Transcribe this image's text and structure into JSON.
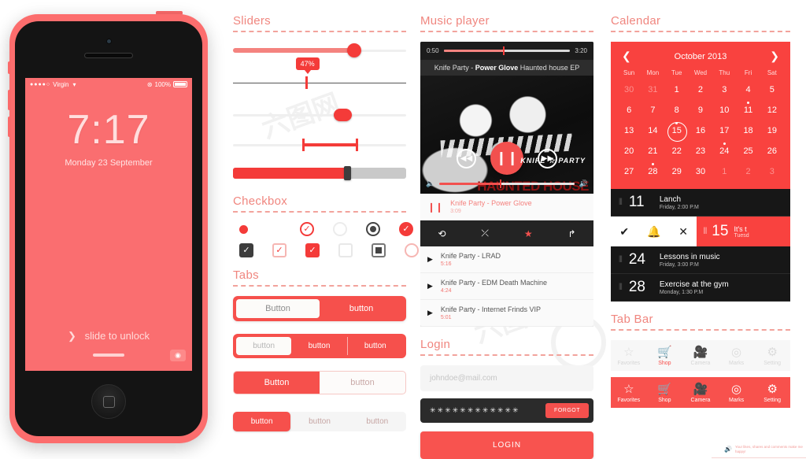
{
  "phone": {
    "status": {
      "carrier": "Virgin",
      "signal_dots": "●●●●○",
      "wifi": "wifi-icon",
      "lock": "⊛",
      "battery_pct": "100%"
    },
    "lock_time": "7:17",
    "lock_date": "Monday 23 September",
    "slide_text": "slide to unlock",
    "slide_chevron": "❯",
    "camera_icon": "◉"
  },
  "sliders": {
    "title": "Sliders",
    "bubble_value": "47%",
    "rows": [
      {
        "name": "filled-knob-slider",
        "value": 78
      },
      {
        "name": "tooltip-tick-slider",
        "value": 47
      },
      {
        "name": "oval-knob-slider",
        "value": 65
      },
      {
        "name": "range-slider",
        "value_from": 42,
        "value_to": 72
      },
      {
        "name": "thick-bar-slider",
        "value": 72
      }
    ]
  },
  "checkbox": {
    "title": "Checkbox",
    "row1": [
      {
        "name": "small-dot",
        "style": "dot-sm",
        "glyph": ""
      },
      {
        "name": "spacer",
        "style": "spacer",
        "glyph": ""
      },
      {
        "name": "ring-check",
        "style": "ring-check",
        "glyph": "✓"
      },
      {
        "name": "ring-empty",
        "style": "ring-empty",
        "glyph": ""
      },
      {
        "name": "radio-selected",
        "style": "radio-on",
        "glyph": ""
      },
      {
        "name": "filled-circle-check",
        "style": "fill-circ",
        "glyph": "✓"
      }
    ],
    "row2": [
      {
        "name": "dark-square-check",
        "style": "sq-dark",
        "glyph": "✓"
      },
      {
        "name": "outline-square-check",
        "style": "sq-outline",
        "glyph": "✓"
      },
      {
        "name": "red-square-check",
        "style": "sq-red",
        "glyph": "✓"
      },
      {
        "name": "empty-square",
        "style": "sq-empty",
        "glyph": ""
      },
      {
        "name": "nested-square",
        "style": "sq-nested",
        "glyph": ""
      },
      {
        "name": "empty-circle",
        "style": "circ-empty",
        "glyph": ""
      }
    ]
  },
  "tabs": {
    "title": "Tabs",
    "group1": [
      {
        "label": "Button",
        "active": true
      },
      {
        "label": "button",
        "active": false
      }
    ],
    "group2": [
      {
        "label": "button",
        "active": true
      },
      {
        "label": "button",
        "active": false
      },
      {
        "label": "button",
        "active": false
      }
    ],
    "group3": [
      {
        "label": "Button",
        "active": true
      },
      {
        "label": "button",
        "active": false
      }
    ],
    "group4": [
      {
        "label": "button",
        "active": true
      },
      {
        "label": "button",
        "active": false
      },
      {
        "label": "button",
        "active": false
      }
    ]
  },
  "music": {
    "title": "Music player",
    "elapsed": "0:50",
    "total": "3:20",
    "meta_artist": "Knife Party - ",
    "meta_track": "Power Glove",
    "meta_album": " Haunted house EP",
    "album_brand": "KNIFE ☆ PARTY",
    "album_brand2": "HAUNTED HOUSE",
    "controls": {
      "prev": "◀◀",
      "play_pause": "❙❙",
      "next": "▶▶",
      "vol_down": "🔈",
      "vol_up": "🔊"
    },
    "now_playing": {
      "icon": "❙❙",
      "title": "Knife Party - Power Glove",
      "duration": "3:09"
    },
    "actions": [
      {
        "name": "repeat-icon",
        "glyph": "⟲"
      },
      {
        "name": "shuffle-icon",
        "glyph": "⤫"
      },
      {
        "name": "favorite-icon",
        "glyph": "★"
      },
      {
        "name": "share-icon",
        "glyph": "↱"
      }
    ],
    "tracks": [
      {
        "icon": "▶",
        "title": "Knife Party - LRAD",
        "duration": "5:16"
      },
      {
        "icon": "▶",
        "title": "Knife Party - EDM Death Machine",
        "duration": "4:24"
      },
      {
        "icon": "▶",
        "title": "Knife Party - Internet Frinds VIP",
        "duration": "5:01"
      }
    ]
  },
  "login": {
    "title": "Login",
    "email_placeholder": "johndoe@mail.com",
    "password_value": "✳✳✳✳✳✳✳✳✳✳✳✳",
    "forgot_label": "FORGOT",
    "login_label": "LOGIN"
  },
  "calendar": {
    "title": "Calendar",
    "prev_icon": "❮",
    "next_icon": "❯",
    "month": "October 2013",
    "dow": [
      "Sun",
      "Mon",
      "Tue",
      "Wed",
      "Thu",
      "Fri",
      "Sat"
    ],
    "days": [
      {
        "d": "30",
        "mute": true
      },
      {
        "d": "31",
        "mute": true
      },
      {
        "d": "1"
      },
      {
        "d": "2"
      },
      {
        "d": "3"
      },
      {
        "d": "4"
      },
      {
        "d": "5"
      },
      {
        "d": "6"
      },
      {
        "d": "7"
      },
      {
        "d": "8"
      },
      {
        "d": "9"
      },
      {
        "d": "10"
      },
      {
        "d": "11",
        "dot": true
      },
      {
        "d": "12"
      },
      {
        "d": "13"
      },
      {
        "d": "14"
      },
      {
        "d": "15",
        "dot": true,
        "sel": true
      },
      {
        "d": "16"
      },
      {
        "d": "17"
      },
      {
        "d": "18"
      },
      {
        "d": "19"
      },
      {
        "d": "20"
      },
      {
        "d": "21"
      },
      {
        "d": "22"
      },
      {
        "d": "23"
      },
      {
        "d": "24",
        "dot": true
      },
      {
        "d": "25"
      },
      {
        "d": "26"
      },
      {
        "d": "27"
      },
      {
        "d": "28",
        "dot": true
      },
      {
        "d": "29"
      },
      {
        "d": "30"
      },
      {
        "d": "1",
        "mute": true
      },
      {
        "d": "2",
        "mute": true
      },
      {
        "d": "3",
        "mute": true
      }
    ],
    "grip": "⦀",
    "events": [
      {
        "day": "11",
        "title": "Lanch",
        "sub": "Friday, 2:00 P.M"
      }
    ],
    "swipe_event": {
      "day": "15",
      "title": "It's t",
      "sub": "Tuesd",
      "actions": [
        "✔",
        "🔔",
        "✕"
      ]
    },
    "events_after": [
      {
        "day": "24",
        "title": "Lessons in music",
        "sub": "Friday, 3:00 P.M"
      },
      {
        "day": "28",
        "title": "Exercise at the gym",
        "sub": "Monday, 1:30 P.M"
      }
    ]
  },
  "tabbar": {
    "title": "Tab Bar",
    "items": [
      {
        "icon": "☆",
        "label": "Favorites",
        "name": "favorites"
      },
      {
        "icon": "🛒",
        "label": "Shop",
        "name": "shop"
      },
      {
        "icon": "🎥",
        "label": "Camera",
        "name": "camera"
      },
      {
        "icon": "◎",
        "label": "Marks",
        "name": "marks"
      },
      {
        "icon": "⚙",
        "label": "Setting",
        "name": "setting"
      }
    ],
    "active_index": 1
  },
  "credit": {
    "icon": "🔊",
    "text": "Your likes, shares and comments make me happy!"
  },
  "watermarks": [
    "六图网",
    "六图网",
    "六图网"
  ]
}
